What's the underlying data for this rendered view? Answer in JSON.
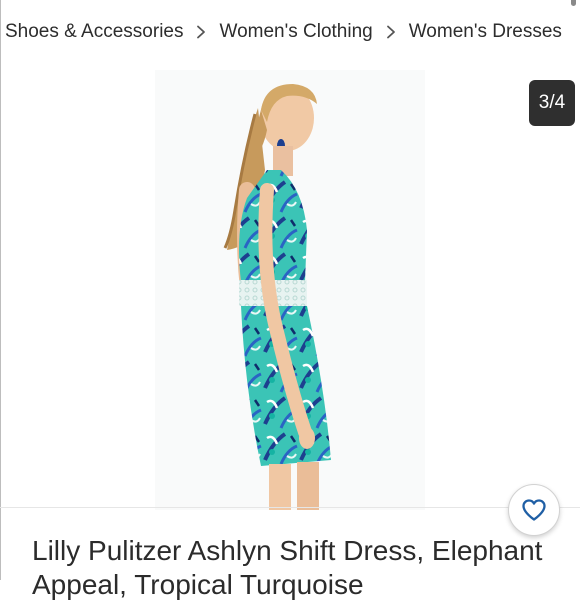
{
  "breadcrumb": {
    "items": [
      {
        "label": "Shoes & Accessories"
      },
      {
        "label": "Women's Clothing"
      },
      {
        "label": "Women's Dresses"
      }
    ],
    "separator_icon": "chevron-right-icon"
  },
  "gallery": {
    "counter": "3/4",
    "photo_alt": "Model wearing turquoise tropical print shift dress with lace waist"
  },
  "like_button": {
    "icon": "heart-outline-icon"
  },
  "listing": {
    "title": "Lilly Pulitzer Ashlyn Shift Dress, Elephant Appeal, Tropical Turquoise"
  },
  "colors": {
    "accent": "#1f5fa5",
    "counter_bg": "#2f2f2f",
    "text": "#2b2b2b",
    "dress_turquoise": "#3bc4b6",
    "dress_navy": "#1d3f8f"
  }
}
